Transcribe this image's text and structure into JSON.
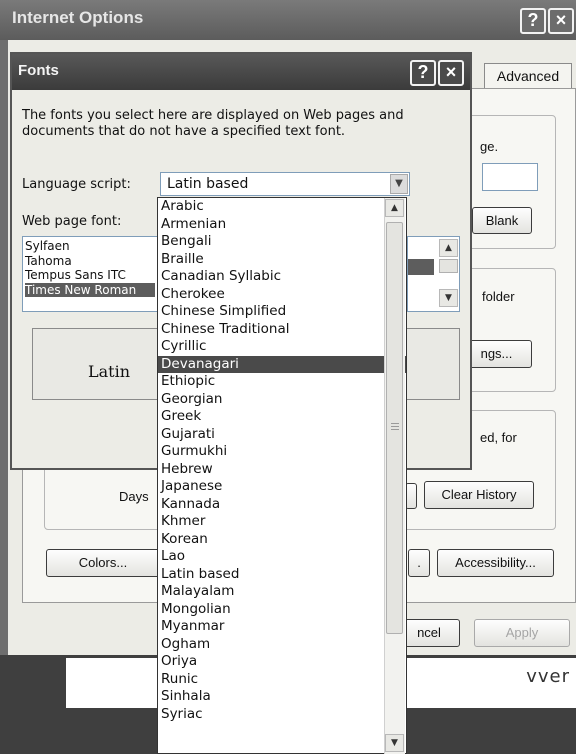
{
  "io": {
    "title": "Internet Options",
    "help_glyph": "?",
    "close_glyph": "×",
    "tab_advanced": "Advanced",
    "home_text_fragment": "ge.",
    "blank_btn": "Blank",
    "folder_text": "folder",
    "settings_btn": "ngs...",
    "cancel_btn_partial": "ncel",
    "used_for_text": "ed, for",
    "days_label": "Days",
    "clear_history_btn": "Clear History",
    "colors_btn": "Colors...",
    "dot_btn": ".",
    "accessibility_btn": "Accessibility...",
    "cancel_bottom_partial": "ncel",
    "apply_btn": "Apply"
  },
  "desktop": {
    "text_fragment": "vver"
  },
  "fonts": {
    "title": "Fonts",
    "description": "The fonts you select here are displayed on Web pages and documents that do not have a specified text font.",
    "language_label": "Language script:",
    "language_value": "Latin based",
    "webfont_label": "Web page font:",
    "font_list": [
      "Sylfaen",
      "Tahoma",
      "Tempus Sans ITC",
      "Times New Roman"
    ],
    "selected_font": "Times New Roman",
    "preview_text": "Latin"
  },
  "dropdown": {
    "items": [
      "Arabic",
      "Armenian",
      "Bengali",
      "Braille",
      "Canadian Syllabic",
      "Cherokee",
      "Chinese Simplified",
      "Chinese Traditional",
      "Cyrillic",
      "Devanagari",
      "Ethiopic",
      "Georgian",
      "Greek",
      "Gujarati",
      "Gurmukhi",
      "Hebrew",
      "Japanese",
      "Kannada",
      "Khmer",
      "Korean",
      "Lao",
      "Latin based",
      "Malayalam",
      "Mongolian",
      "Myanmar",
      "Ogham",
      "Oriya",
      "Runic",
      "Sinhala",
      "Syriac"
    ],
    "selected": "Devanagari"
  },
  "colors": {
    "selection": "#4a4a4a",
    "title_bar": "#3b3b3b"
  }
}
